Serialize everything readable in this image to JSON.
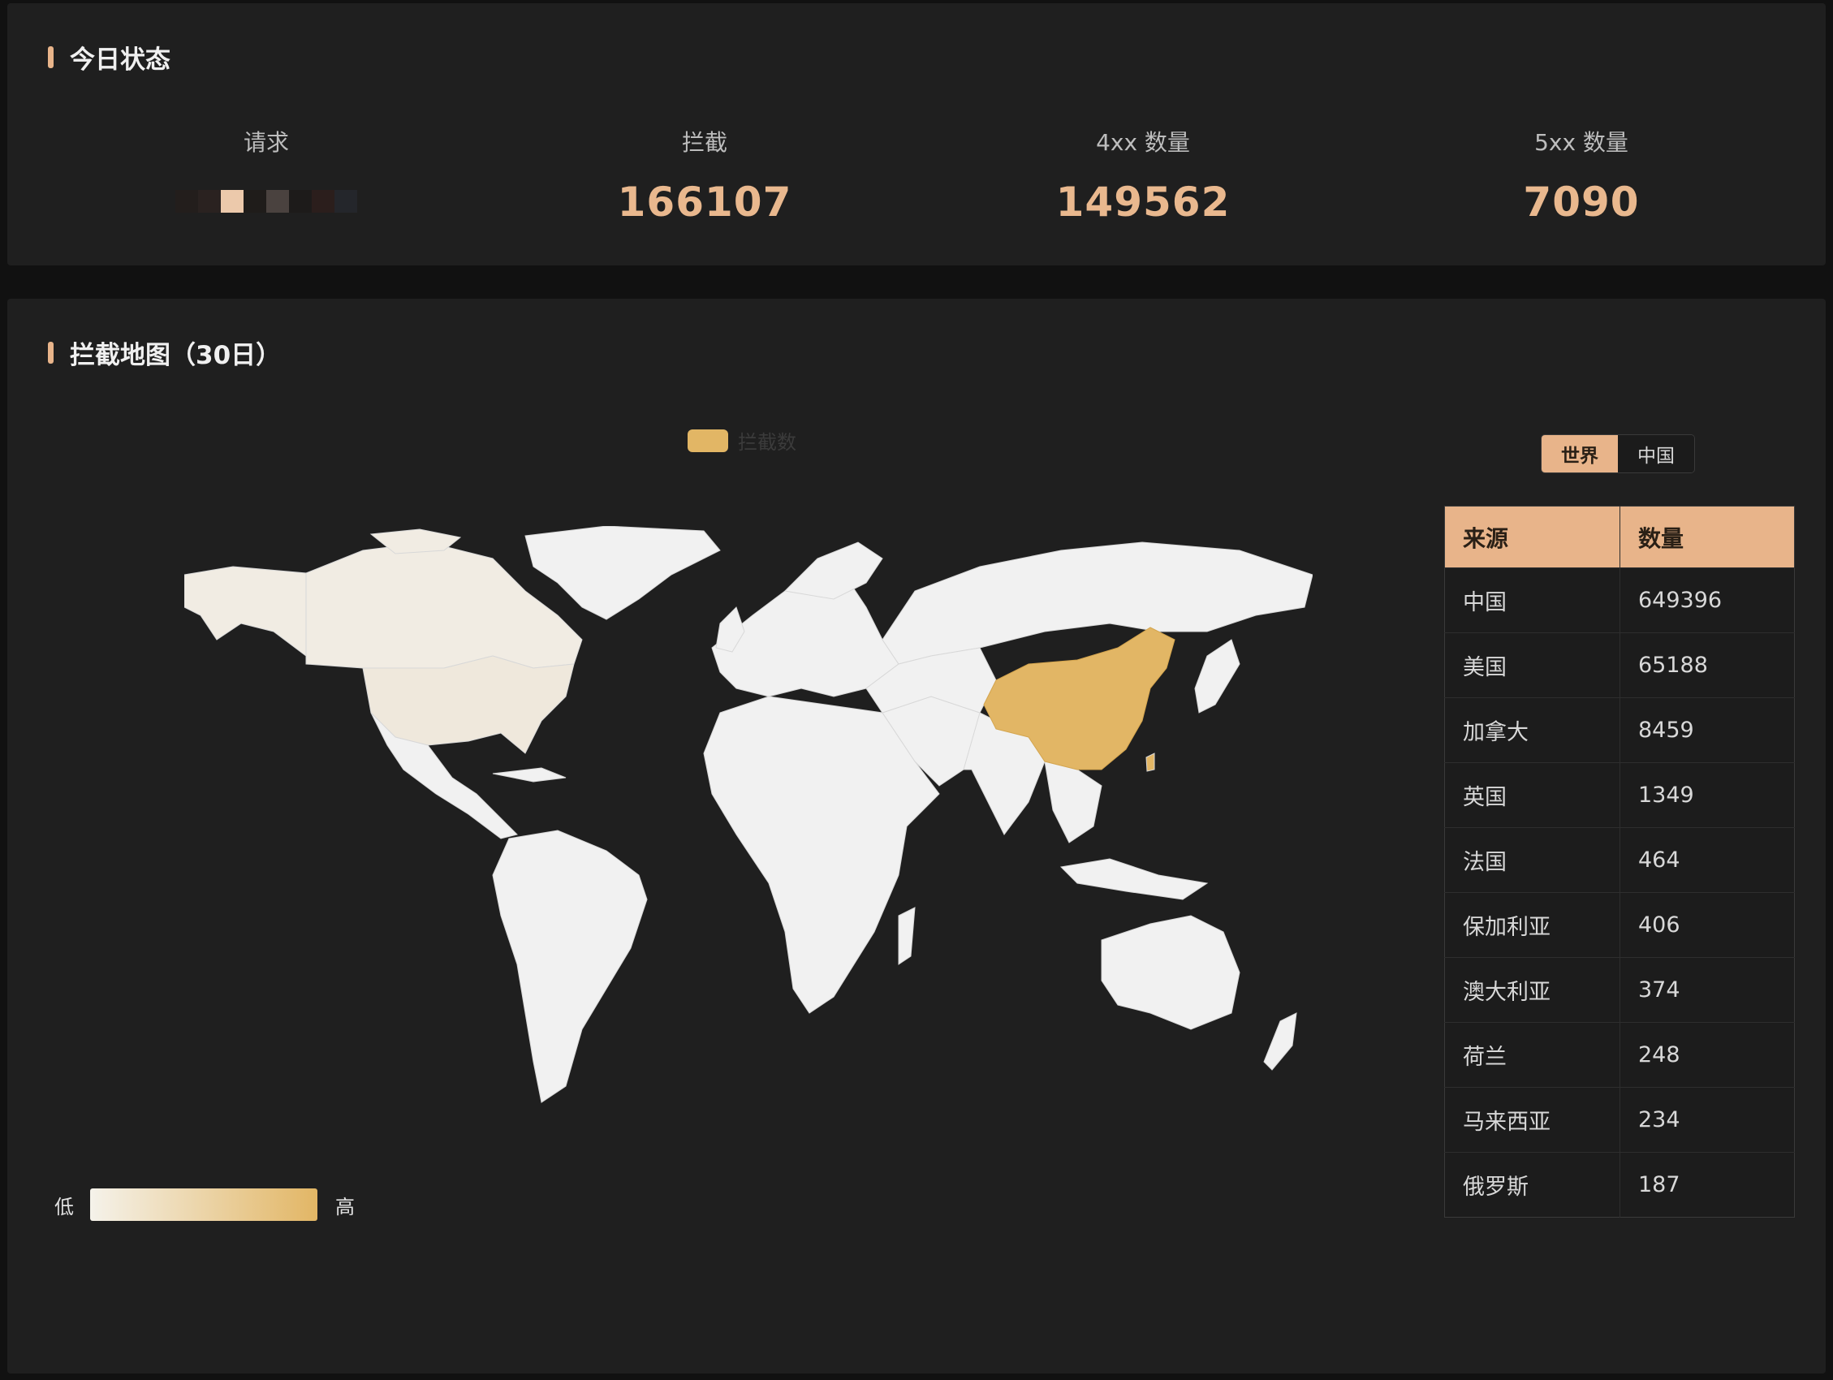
{
  "today": {
    "title": "今日状态",
    "stats": [
      {
        "label": "请求",
        "value": null
      },
      {
        "label": "拦截",
        "value": "166107"
      },
      {
        "label": "4xx 数量",
        "value": "149562"
      },
      {
        "label": "5xx 数量",
        "value": "7090"
      }
    ]
  },
  "map_panel": {
    "title": "拦截地图（30日）",
    "legend_label": "拦截数",
    "visual_map": {
      "low": "低",
      "high": "高",
      "color_low": "#f5f2ea",
      "color_high": "#e2b665"
    },
    "toggle": {
      "world": "世界",
      "china": "中国",
      "active": "world"
    },
    "table": {
      "headers": [
        "来源",
        "数量"
      ],
      "rows": [
        [
          "中国",
          "649396"
        ],
        [
          "美国",
          "65188"
        ],
        [
          "加拿大",
          "8459"
        ],
        [
          "英国",
          "1349"
        ],
        [
          "法国",
          "464"
        ],
        [
          "保加利亚",
          "406"
        ],
        [
          "澳大利亚",
          "374"
        ],
        [
          "荷兰",
          "248"
        ],
        [
          "马来西亚",
          "234"
        ],
        [
          "俄罗斯",
          "187"
        ]
      ]
    }
  },
  "colors": {
    "accent": "#e8b48a",
    "map_highlight": "#e2b665",
    "map_land": "#f1f1f1"
  }
}
